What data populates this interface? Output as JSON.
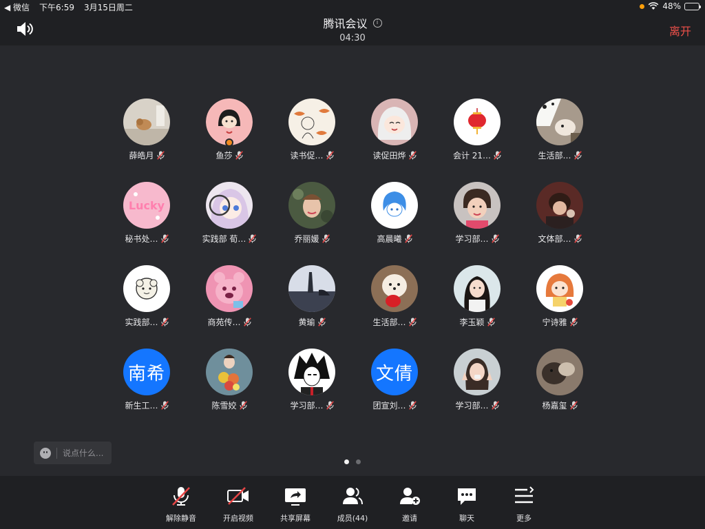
{
  "status_bar": {
    "back_app": "◀ 微信",
    "time": "下午6:59",
    "date": "3月15日周二",
    "battery": "48%",
    "battery_level": 0.48
  },
  "header": {
    "title": "腾讯会议",
    "info_glyph": "i",
    "timer": "04:30",
    "leave_label": "离开"
  },
  "participants": [
    {
      "name": "薛皓月",
      "avatar": "photo-dog-room",
      "muted": true
    },
    {
      "name": "鱼莎",
      "avatar": "cartoon-girl-pink",
      "muted": true
    },
    {
      "name": "读书促…",
      "avatar": "sketch-fish",
      "muted": true
    },
    {
      "name": "读促田烨",
      "avatar": "anime-white-hair",
      "muted": true
    },
    {
      "name": "会计 21…",
      "avatar": "red-lantern",
      "muted": true
    },
    {
      "name": "生活部…",
      "avatar": "photo-dog-hat",
      "muted": true
    },
    {
      "name": "秘书处…",
      "avatar": "pink-lucky",
      "muted": true
    },
    {
      "name": "实践部 荀…",
      "avatar": "anime-purple-hair",
      "muted": true
    },
    {
      "name": "乔丽媛",
      "avatar": "photo-portrait",
      "muted": true
    },
    {
      "name": "高晨曦",
      "avatar": "anime-blue-sketch",
      "muted": true
    },
    {
      "name": "学习部…",
      "avatar": "photo-child",
      "muted": true
    },
    {
      "name": "文体部…",
      "avatar": "photo-person-dark",
      "muted": true
    },
    {
      "name": "实践部…",
      "avatar": "sheep-doodle",
      "muted": true
    },
    {
      "name": "商苑传…",
      "avatar": "pink-bear",
      "muted": true
    },
    {
      "name": "黄瑜",
      "avatar": "photo-lake",
      "muted": true
    },
    {
      "name": "生活部…",
      "avatar": "white-dog-red",
      "muted": true
    },
    {
      "name": "李玉颖",
      "avatar": "photo-girl",
      "muted": true
    },
    {
      "name": "宁诗雅",
      "avatar": "cartoon-girl-orange",
      "muted": true
    },
    {
      "name": "新生工…",
      "avatar_text": "南希",
      "muted": true
    },
    {
      "name": "陈雪姣",
      "avatar": "photo-flowers",
      "muted": true
    },
    {
      "name": "学习部…",
      "avatar": "manga-boy",
      "muted": true
    },
    {
      "name": "团宣刘…",
      "avatar_text": "文倩",
      "muted": true
    },
    {
      "name": "学习部…",
      "avatar": "photo-girl-peace",
      "muted": true
    },
    {
      "name": "杨嘉玺",
      "avatar": "photo-pet-blur",
      "muted": true
    }
  ],
  "chat": {
    "placeholder": "说点什么..."
  },
  "pagination": {
    "pages": 2,
    "current": 1
  },
  "toolbar": [
    {
      "label": "解除静音",
      "icon": "mic-muted-icon"
    },
    {
      "label": "开启视频",
      "icon": "video-off-icon"
    },
    {
      "label": "共享屏幕",
      "icon": "share-screen-icon"
    },
    {
      "label": "成员(44)",
      "icon": "members-icon"
    },
    {
      "label": "邀请",
      "icon": "invite-icon"
    },
    {
      "label": "聊天",
      "icon": "chat-icon"
    },
    {
      "label": "更多",
      "icon": "more-icon"
    }
  ],
  "colors": {
    "background": "#28292d",
    "bar": "#1f2023",
    "leave": "#f0504a",
    "text_avatar": "#1476ff",
    "mute_red": "#e64545"
  }
}
